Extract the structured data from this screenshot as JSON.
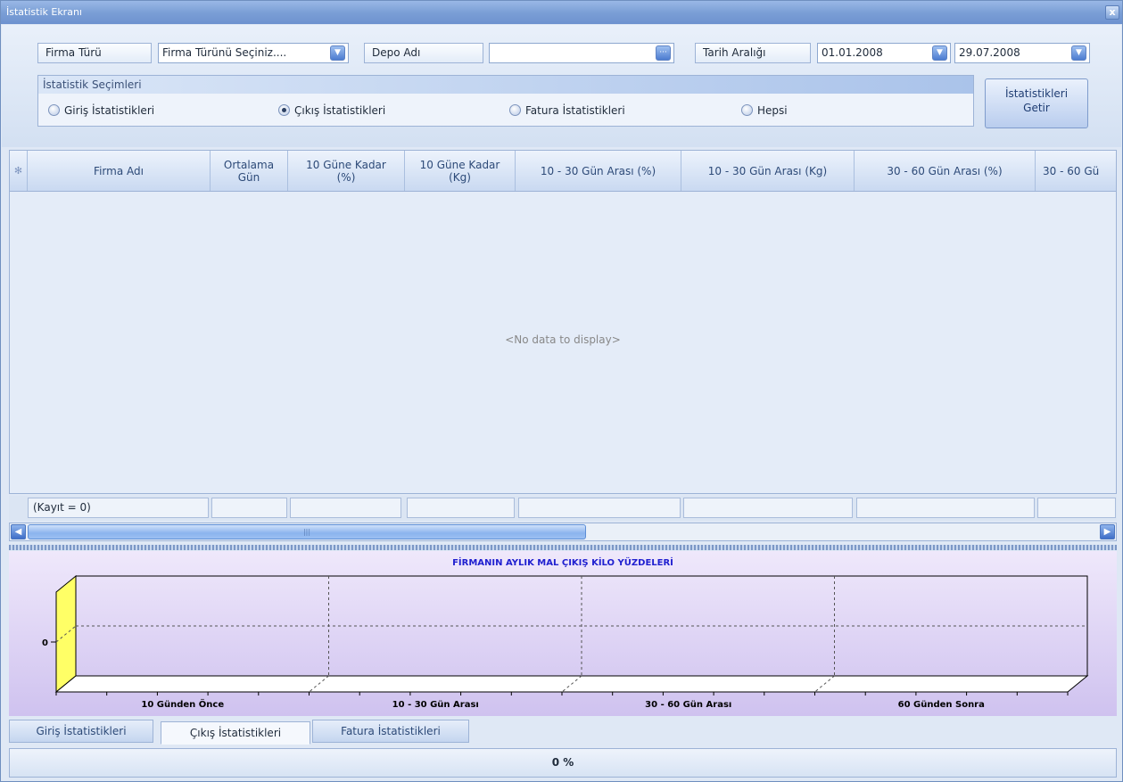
{
  "window": {
    "title": "İstatistik Ekranı",
    "close_label": "x"
  },
  "filters": {
    "firma_turu_label": "Firma Türü",
    "firma_turu_value": "Firma Türünü Seçiniz....",
    "depo_adi_label": "Depo Adı",
    "depo_adi_value": "",
    "tarih_label": "Tarih Aralığı",
    "tarih_start": "01.01.2008",
    "tarih_end": "29.07.2008"
  },
  "selections": {
    "group_title": "İstatistik Seçimleri",
    "options": [
      {
        "label": "Giriş İstatistikleri",
        "checked": false
      },
      {
        "label": "Çıkış İstatistikleri",
        "checked": true
      },
      {
        "label": "Fatura İstatistikleri",
        "checked": false
      },
      {
        "label": "Hepsi",
        "checked": false
      }
    ]
  },
  "get_button": {
    "line1": "İstatistikleri",
    "line2": "Getir"
  },
  "grid": {
    "columns": [
      {
        "line1": "Firma Adı",
        "line2": ""
      },
      {
        "line1": "Ortalama",
        "line2": "Gün"
      },
      {
        "line1": "10 Güne Kadar",
        "line2": "(%)"
      },
      {
        "line1": "10 Güne Kadar",
        "line2": "(Kg)"
      },
      {
        "line1": "10 - 30 Gün Arası (%)",
        "line2": ""
      },
      {
        "line1": "10 - 30 Gün Arası (Kg)",
        "line2": ""
      },
      {
        "line1": "30 - 60 Gün Arası (%)",
        "line2": ""
      },
      {
        "line1": "30 - 60 Gü",
        "line2": ""
      }
    ],
    "empty_text": "<No data to display>",
    "footer_count": "(Kayıt = 0)",
    "new_row_glyph": "✻"
  },
  "chart_data": {
    "type": "bar",
    "title": "FİRMANIN AYLIK MAL ÇIKIŞ KİLO YÜZDELERİ",
    "categories": [
      "10 Günden Önce",
      "10 - 30 Gün Arası",
      "30 - 60 Gün Arası",
      "60 Günden Sonra"
    ],
    "values": [
      0,
      0,
      0,
      0
    ],
    "yticks": [
      "0"
    ],
    "grid": true,
    "three_d": true
  },
  "tabs": [
    {
      "label": "Giriş İstatistikleri",
      "active": false
    },
    {
      "label": "Çıkış İstatistikleri",
      "active": true
    },
    {
      "label": "Fatura İstatistikleri",
      "active": false
    }
  ],
  "status": {
    "progress": "0 %"
  },
  "colors": {
    "accent": "#7b9fd6",
    "chart_title": "#2020d0",
    "wall": "#ffff66"
  }
}
